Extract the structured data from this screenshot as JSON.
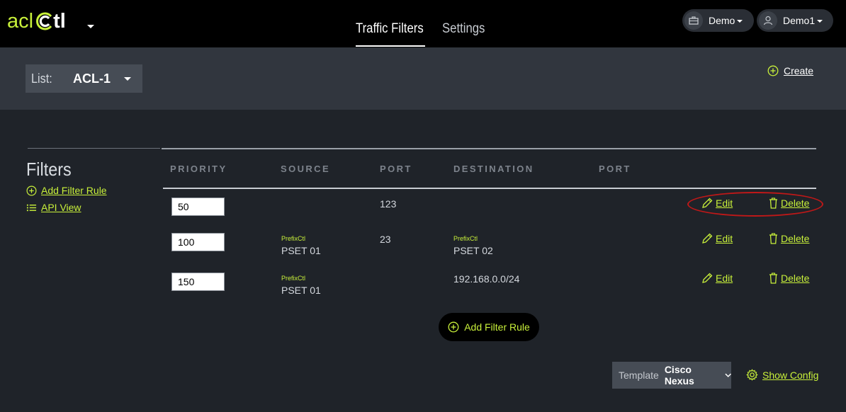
{
  "app": {
    "logo_left": "acl",
    "logo_right": "tl"
  },
  "nav": {
    "tabs": [
      {
        "label": "Traffic Filters",
        "active": true
      },
      {
        "label": "Settings",
        "active": false
      }
    ]
  },
  "header": {
    "org_label": "Demo",
    "user_label": "Demo1"
  },
  "list_selector": {
    "label": "List:",
    "value": "ACL-1"
  },
  "create_label": "Create",
  "sidebar": {
    "title": "Filters",
    "add_rule_label": "Add Filter Rule",
    "api_view_label": "API View"
  },
  "table": {
    "columns": [
      "PRIORITY",
      "SOURCE",
      "PORT",
      "DESTINATION",
      "PORT"
    ],
    "rows": [
      {
        "priority": "50",
        "source_tag": "",
        "source": "",
        "source_port": "123",
        "dest_tag": "",
        "destination": "",
        "dest_port": "",
        "edit_label": "Edit",
        "delete_label": "Delete",
        "highlighted": true
      },
      {
        "priority": "100",
        "source_tag": "PrefixCtl",
        "source": "PSET 01",
        "source_port": "23",
        "dest_tag": "PrefixCtl",
        "destination": "PSET 02",
        "dest_port": "",
        "edit_label": "Edit",
        "delete_label": "Delete",
        "highlighted": false
      },
      {
        "priority": "150",
        "source_tag": "PrefixCtl",
        "source": "PSET 01",
        "source_port": "",
        "dest_tag": "",
        "destination": "192.168.0.0/24",
        "dest_port": "",
        "edit_label": "Edit",
        "delete_label": "Delete",
        "highlighted": false
      }
    ]
  },
  "add_filter_button_label": "Add Filter Rule",
  "template": {
    "label": "Template",
    "value": "Cisco Nexus"
  },
  "show_config_label": "Show Config",
  "colors": {
    "accent": "#c8f03a",
    "topbar": "#000000",
    "band": "#31363e",
    "background": "#1f2329",
    "highlight": "#c01818"
  }
}
